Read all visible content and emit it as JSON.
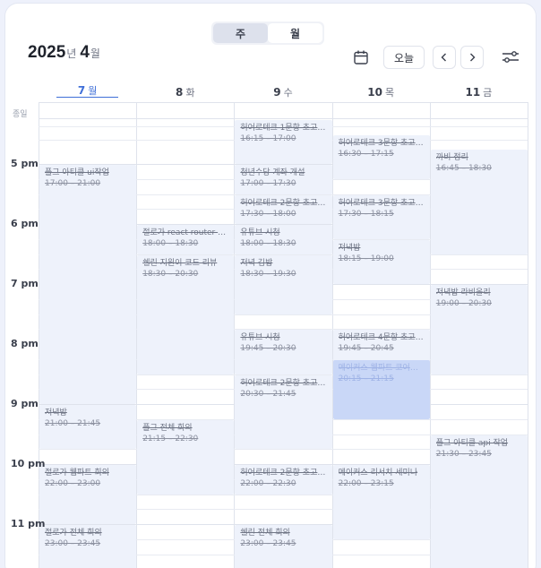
{
  "header": {
    "view_toggle": {
      "week_label": "주",
      "month_label": "월"
    },
    "year": "2025",
    "year_unit": "년",
    "month": "4",
    "month_unit": "월",
    "today_label": "오늘",
    "icons": {
      "calendar": "calendar-icon",
      "prev": "chevron-left-icon",
      "next": "chevron-right-icon",
      "filter": "sliders-icon"
    }
  },
  "days": [
    {
      "num": "7",
      "name": "월",
      "today": true
    },
    {
      "num": "8",
      "name": "화"
    },
    {
      "num": "9",
      "name": "수"
    },
    {
      "num": "10",
      "name": "목"
    },
    {
      "num": "11",
      "name": "금"
    }
  ],
  "allday_label": "종일",
  "hours": [
    "5 pm",
    "6 pm",
    "7 pm",
    "8 pm",
    "9 pm",
    "10 pm",
    "11 pm"
  ],
  "events": [
    {
      "day": 0,
      "title": "플그 아티클 ui작업",
      "time": "17:00 – 21:00",
      "start": "17:00",
      "end": "21:00"
    },
    {
      "day": 0,
      "title": "저녁밥",
      "time": "21:00 – 21:45",
      "start": "21:00",
      "end": "21:45"
    },
    {
      "day": 0,
      "title": "절로가 웹파트 회의",
      "time": "22:00 – 23:00",
      "start": "22:00",
      "end": "23:00"
    },
    {
      "day": 0,
      "title": "절로가 전체 회의",
      "time": "23:00 – 23:45",
      "start": "23:00",
      "end": "23:45"
    },
    {
      "day": 1,
      "title": "절로가 react router d...",
      "time": "18:00 – 18:30",
      "start": "18:00",
      "end": "18:30"
    },
    {
      "day": 1,
      "title": "쉘린 지원이 코드 리뷰",
      "time": "18:30 – 20:30",
      "start": "18:30",
      "end": "20:30"
    },
    {
      "day": 1,
      "title": "플그 전체 회의",
      "time": "21:15 – 22:30",
      "start": "21:15",
      "end": "22:30"
    },
    {
      "day": 2,
      "title": "허어로테크 1문항 초고 ...",
      "time": "16:15 – 17:00",
      "start": "16:15",
      "end": "17:00"
    },
    {
      "day": 2,
      "title": "청년수당 계좌 개설",
      "time": "17:00 – 17:30",
      "start": "17:00",
      "end": "17:30"
    },
    {
      "day": 2,
      "title": "허어로테크 2문항 초고 ...",
      "time": "17:30 – 18:00",
      "start": "17:30",
      "end": "18:00"
    },
    {
      "day": 2,
      "title": "유튜브 시청",
      "time": "18:00 – 18:30",
      "start": "18:00",
      "end": "18:30"
    },
    {
      "day": 2,
      "title": "저녁 김밥",
      "time": "18:30 – 19:30",
      "start": "18:30",
      "end": "19:30"
    },
    {
      "day": 2,
      "title": "유튜브 시청",
      "time": "19:45 – 20:30",
      "start": "19:45",
      "end": "20:30"
    },
    {
      "day": 2,
      "title": "허어로테크 2문항 초고 ...",
      "time": "20:30 – 21:45",
      "start": "20:30",
      "end": "21:45"
    },
    {
      "day": 2,
      "title": "허어로테크 2문항 초고 ...",
      "time": "22:00 – 22:30",
      "start": "22:00",
      "end": "22:30"
    },
    {
      "day": 2,
      "title": "쉘린 전체 회의",
      "time": "23:00 – 23:45",
      "start": "23:00",
      "end": "23:45"
    },
    {
      "day": 3,
      "title": "허어로테크 3문항 초고 ...",
      "time": "16:30 – 17:15",
      "start": "16:30",
      "end": "17:15"
    },
    {
      "day": 3,
      "title": "허어로테크 3문항 초고 ...",
      "time": "17:30 – 18:15",
      "start": "17:30",
      "end": "18:15"
    },
    {
      "day": 3,
      "title": "저녁밥",
      "time": "18:15 – 19:00",
      "start": "18:15",
      "end": "19:00"
    },
    {
      "day": 3,
      "title": "허어로테크 4문항 초고 ...",
      "time": "19:45 – 20:45",
      "start": "19:45",
      "end": "20:45"
    },
    {
      "day": 3,
      "title": "메이커스 웹파트 코어타임",
      "time": "20:15 – 21:15",
      "start": "20:15",
      "end": "21:15",
      "selected": true
    },
    {
      "day": 3,
      "title": "메이커스 리서치 세미나",
      "time": "22:00 – 23:15",
      "start": "22:00",
      "end": "23:15"
    },
    {
      "day": 4,
      "title": "까비 정리",
      "time": "16:45 – 18:30",
      "start": "16:45",
      "end": "18:30"
    },
    {
      "day": 4,
      "title": "저녁밥 라비올리",
      "time": "19:00 – 20:30",
      "start": "19:00",
      "end": "20:30"
    },
    {
      "day": 4,
      "title": "플그 아티클 api 작업",
      "time": "21:30 – 23:45",
      "start": "21:30",
      "end": "23:45"
    }
  ]
}
